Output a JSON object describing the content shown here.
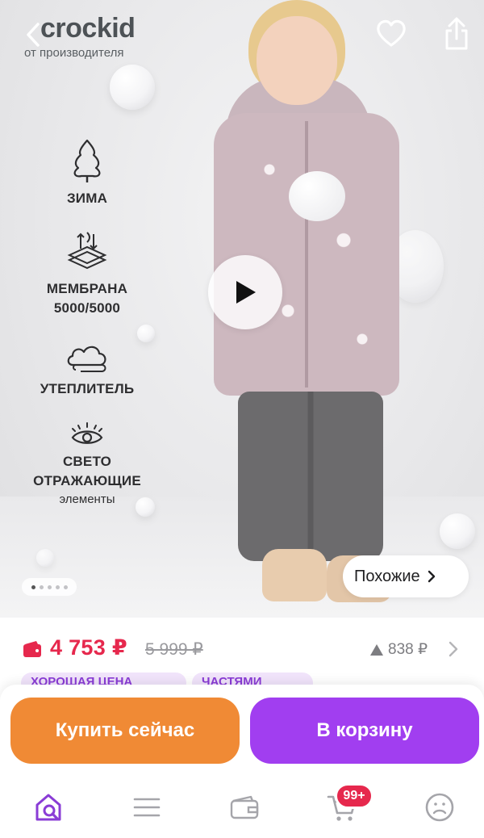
{
  "header": {
    "brand_logo": "crockid",
    "brand_subtitle": "от производителя",
    "back_icon": "chevron-left-icon",
    "favorite_icon": "heart-icon",
    "share_icon": "share-icon"
  },
  "features": [
    {
      "icon": "snow-tree-icon",
      "line1": "ЗИМА",
      "line2": ""
    },
    {
      "icon": "membrane-icon",
      "line1": "МЕМБРАНА",
      "line2": "5000/5000"
    },
    {
      "icon": "cloud-insulation-icon",
      "line1": "УТЕПЛИТЕЛЬ",
      "line2": ""
    },
    {
      "icon": "eye-icon",
      "line1": "СВЕТО",
      "line1b": "ОТРАЖАЮЩИЕ",
      "line2": "элементы"
    }
  ],
  "gallery": {
    "dots_total": 5,
    "active_index": 0,
    "similar_label": "Похожие"
  },
  "price": {
    "current": "4 753 ₽",
    "old": "5 999 ₽",
    "points": "838 ₽"
  },
  "badges": [
    "ХОРОШАЯ ЦЕНА",
    "ЧАСТЯМИ"
  ],
  "actions": {
    "buy_now": "Купить сейчас",
    "add_to_cart": "В корзину"
  },
  "nav": {
    "cart_count": "99+"
  },
  "colors": {
    "price": "#e6284d",
    "buy_button": "#f08a35",
    "cart_button": "#a13ef0",
    "nav_active": "#8a3cd6"
  }
}
